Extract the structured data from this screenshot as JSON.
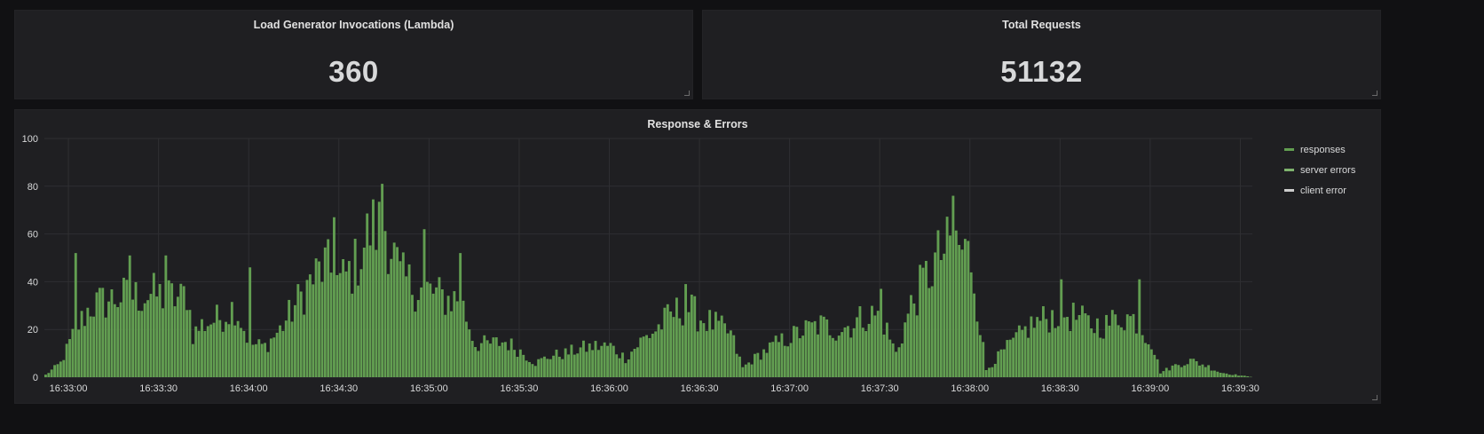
{
  "panels": {
    "invocations": {
      "title": "Load Generator Invocations (Lambda)",
      "value": "360"
    },
    "total_requests": {
      "title": "Total Requests",
      "value": "51132"
    },
    "graph": {
      "title": "Response & Errors"
    }
  },
  "colors": {
    "responses": "#629e51",
    "server_errors": "#7eb26d",
    "client_error": "#cccccc"
  },
  "chart_data": {
    "type": "bar",
    "title": "Response & Errors",
    "xlabel": "",
    "ylabel": "",
    "ylim": [
      0,
      100
    ],
    "yticks": [
      "0",
      "20",
      "40",
      "60",
      "80",
      "100"
    ],
    "xticks": [
      "16:33:00",
      "16:33:30",
      "16:34:00",
      "16:34:30",
      "16:35:00",
      "16:35:30",
      "16:36:00",
      "16:36:30",
      "16:37:00",
      "16:37:30",
      "16:38:00",
      "16:38:30",
      "16:39:00",
      "16:39:30"
    ],
    "x_start": "16:32:52",
    "x_end": "16:39:34",
    "grid": true,
    "legend_position": "right",
    "series": [
      {
        "name": "responses",
        "color": "#629e51",
        "envelope": [
          {
            "t": "16:32:52",
            "v": 1
          },
          {
            "t": "16:32:57",
            "v": 6
          },
          {
            "t": "16:33:02",
            "v": 20
          },
          {
            "t": "16:33:07",
            "v": 30
          },
          {
            "t": "16:33:12",
            "v": 32
          },
          {
            "t": "16:33:17",
            "v": 34
          },
          {
            "t": "16:33:22",
            "v": 34
          },
          {
            "t": "16:33:27",
            "v": 35
          },
          {
            "t": "16:33:32",
            "v": 34
          },
          {
            "t": "16:33:37",
            "v": 33
          },
          {
            "t": "16:33:39",
            "v": 36
          },
          {
            "t": "16:33:41",
            "v": 18
          },
          {
            "t": "16:33:44",
            "v": 22
          },
          {
            "t": "16:33:50",
            "v": 25
          },
          {
            "t": "16:33:55",
            "v": 30
          },
          {
            "t": "16:34:00",
            "v": 14
          },
          {
            "t": "16:34:05",
            "v": 13
          },
          {
            "t": "16:34:10",
            "v": 20
          },
          {
            "t": "16:34:15",
            "v": 30
          },
          {
            "t": "16:34:20",
            "v": 40
          },
          {
            "t": "16:34:25",
            "v": 47
          },
          {
            "t": "16:34:30",
            "v": 40
          },
          {
            "t": "16:34:35",
            "v": 47
          },
          {
            "t": "16:34:40",
            "v": 62
          },
          {
            "t": "16:34:45",
            "v": 64
          },
          {
            "t": "16:34:50",
            "v": 42
          },
          {
            "t": "16:34:55",
            "v": 38
          },
          {
            "t": "16:35:00",
            "v": 36
          },
          {
            "t": "16:35:05",
            "v": 33
          },
          {
            "t": "16:35:10",
            "v": 33
          },
          {
            "t": "16:35:15",
            "v": 14
          },
          {
            "t": "16:35:20",
            "v": 14
          },
          {
            "t": "16:35:25",
            "v": 15
          },
          {
            "t": "16:35:30",
            "v": 11
          },
          {
            "t": "16:35:35",
            "v": 6
          },
          {
            "t": "16:35:40",
            "v": 9
          },
          {
            "t": "16:35:45",
            "v": 10
          },
          {
            "t": "16:35:50",
            "v": 12
          },
          {
            "t": "16:35:55",
            "v": 13
          },
          {
            "t": "16:36:00",
            "v": 13
          },
          {
            "t": "16:36:05",
            "v": 8
          },
          {
            "t": "16:36:10",
            "v": 15
          },
          {
            "t": "16:36:15",
            "v": 20
          },
          {
            "t": "16:36:20",
            "v": 26
          },
          {
            "t": "16:36:25",
            "v": 30
          },
          {
            "t": "16:36:30",
            "v": 25
          },
          {
            "t": "16:36:35",
            "v": 22
          },
          {
            "t": "16:36:40",
            "v": 18
          },
          {
            "t": "16:36:44",
            "v": 4
          },
          {
            "t": "16:36:50",
            "v": 10
          },
          {
            "t": "16:36:55",
            "v": 14
          },
          {
            "t": "16:37:00",
            "v": 17
          },
          {
            "t": "16:37:05",
            "v": 20
          },
          {
            "t": "16:37:10",
            "v": 22
          },
          {
            "t": "16:37:15",
            "v": 20
          },
          {
            "t": "16:37:20",
            "v": 22
          },
          {
            "t": "16:37:25",
            "v": 26
          },
          {
            "t": "16:37:30",
            "v": 26
          },
          {
            "t": "16:37:35",
            "v": 10
          },
          {
            "t": "16:37:40",
            "v": 30
          },
          {
            "t": "16:37:45",
            "v": 42
          },
          {
            "t": "16:37:50",
            "v": 52
          },
          {
            "t": "16:37:55",
            "v": 56
          },
          {
            "t": "16:38:00",
            "v": 50
          },
          {
            "t": "16:38:05",
            "v": 3
          },
          {
            "t": "16:38:10",
            "v": 10
          },
          {
            "t": "16:38:15",
            "v": 16
          },
          {
            "t": "16:38:20",
            "v": 22
          },
          {
            "t": "16:38:25",
            "v": 25
          },
          {
            "t": "16:38:30",
            "v": 27
          },
          {
            "t": "16:38:35",
            "v": 25
          },
          {
            "t": "16:38:40",
            "v": 22
          },
          {
            "t": "16:38:45",
            "v": 22
          },
          {
            "t": "16:38:50",
            "v": 26
          },
          {
            "t": "16:38:55",
            "v": 24
          },
          {
            "t": "16:39:00",
            "v": 15
          },
          {
            "t": "16:39:03",
            "v": 2
          },
          {
            "t": "16:39:08",
            "v": 5
          },
          {
            "t": "16:39:13",
            "v": 7
          },
          {
            "t": "16:39:18",
            "v": 5
          },
          {
            "t": "16:39:23",
            "v": 2
          },
          {
            "t": "16:39:28",
            "v": 1
          },
          {
            "t": "16:39:34",
            "v": 0
          }
        ],
        "peaks": [
          {
            "t": "16:33:02",
            "v": 52
          },
          {
            "t": "16:33:20",
            "v": 51
          },
          {
            "t": "16:33:32",
            "v": 51
          },
          {
            "t": "16:34:00",
            "v": 46
          },
          {
            "t": "16:34:28",
            "v": 67
          },
          {
            "t": "16:34:44",
            "v": 81
          },
          {
            "t": "16:34:58",
            "v": 62
          },
          {
            "t": "16:35:10",
            "v": 52
          },
          {
            "t": "16:36:25",
            "v": 39
          },
          {
            "t": "16:37:30",
            "v": 37
          },
          {
            "t": "16:37:54",
            "v": 76
          },
          {
            "t": "16:38:30",
            "v": 41
          },
          {
            "t": "16:38:56",
            "v": 41
          }
        ]
      },
      {
        "name": "server errors",
        "color": "#7eb26d",
        "values": []
      },
      {
        "name": "client error",
        "color": "#cccccc",
        "values": []
      }
    ]
  }
}
